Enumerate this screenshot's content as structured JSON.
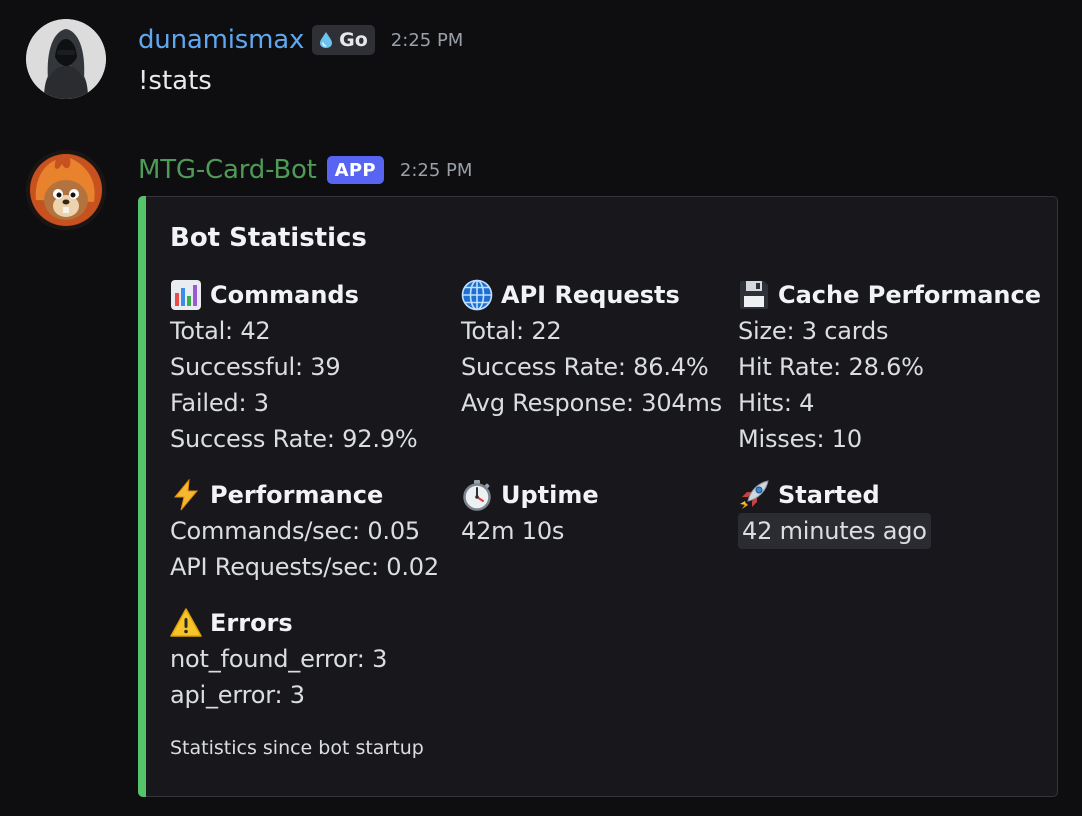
{
  "messages": {
    "user": {
      "username": "dunamismax",
      "tag": "Go",
      "time": "2:25 PM",
      "content": "!stats",
      "avatar_icon": "hooded-figure-avatar"
    },
    "bot": {
      "username": "MTG-Card-Bot",
      "tag": "APP",
      "time": "2:25 PM",
      "avatar_icon": "fire-creature-avatar"
    }
  },
  "embed": {
    "accent_color": "#55c36a",
    "title": "Bot Statistics",
    "fields": {
      "commands": {
        "icon": "bar-chart-icon",
        "name": "Commands",
        "lines": [
          "Total: 42",
          "Successful: 39",
          "Failed: 3",
          "Success Rate: 92.9%"
        ]
      },
      "api": {
        "icon": "globe-icon",
        "name": "API Requests",
        "lines": [
          "Total: 22",
          "Success Rate: 86.4%",
          "Avg Response: 304ms"
        ]
      },
      "cache": {
        "icon": "floppy-disk-icon",
        "name": "Cache Performance",
        "lines": [
          "Size: 3 cards",
          "Hit Rate: 28.6%",
          "Hits: 4",
          "Misses: 10"
        ]
      },
      "performance": {
        "icon": "lightning-icon",
        "name": "Performance",
        "lines": [
          "Commands/sec: 0.05",
          "API Requests/sec: 0.02"
        ]
      },
      "uptime": {
        "icon": "stopwatch-icon",
        "name": "Uptime",
        "lines": [
          "42m 10s"
        ]
      },
      "started": {
        "icon": "rocket-icon",
        "name": "Started",
        "lines": [
          "42 minutes ago"
        ]
      },
      "errors": {
        "icon": "warning-icon",
        "name": "Errors",
        "lines": [
          "not_found_error: 3",
          "api_error: 3"
        ]
      }
    },
    "footer": "Statistics since bot startup"
  }
}
